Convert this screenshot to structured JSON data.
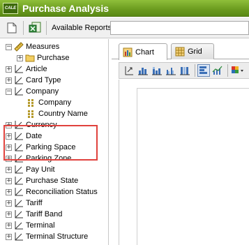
{
  "app": {
    "title": "Purchase Analysis",
    "logo_text": "CALE"
  },
  "toolbar": {
    "available_reports_label": "Available Reports",
    "available_reports_value": ""
  },
  "tree": {
    "measures": {
      "label": "Measures",
      "children": [
        {
          "label": "Purchase"
        }
      ]
    },
    "dimensions": [
      {
        "label": "Article"
      },
      {
        "label": "Card Type"
      },
      {
        "label": "Company",
        "children": [
          {
            "label": "Company"
          },
          {
            "label": "Country Name"
          }
        ]
      },
      {
        "label": "Currency"
      },
      {
        "label": "Date"
      },
      {
        "label": "Parking Space"
      },
      {
        "label": "Parking Zone"
      },
      {
        "label": "Pay Unit"
      },
      {
        "label": "Purchase State"
      },
      {
        "label": "Reconciliation Status"
      },
      {
        "label": "Tariff"
      },
      {
        "label": "Tariff Band"
      },
      {
        "label": "Terminal"
      },
      {
        "label": "Terminal Structure"
      }
    ]
  },
  "tabs": [
    {
      "label": "Chart",
      "active": true
    },
    {
      "label": "Grid",
      "active": false
    }
  ],
  "colors": {
    "title_bar": "#6a9a1e",
    "highlight": "#e0423d"
  }
}
